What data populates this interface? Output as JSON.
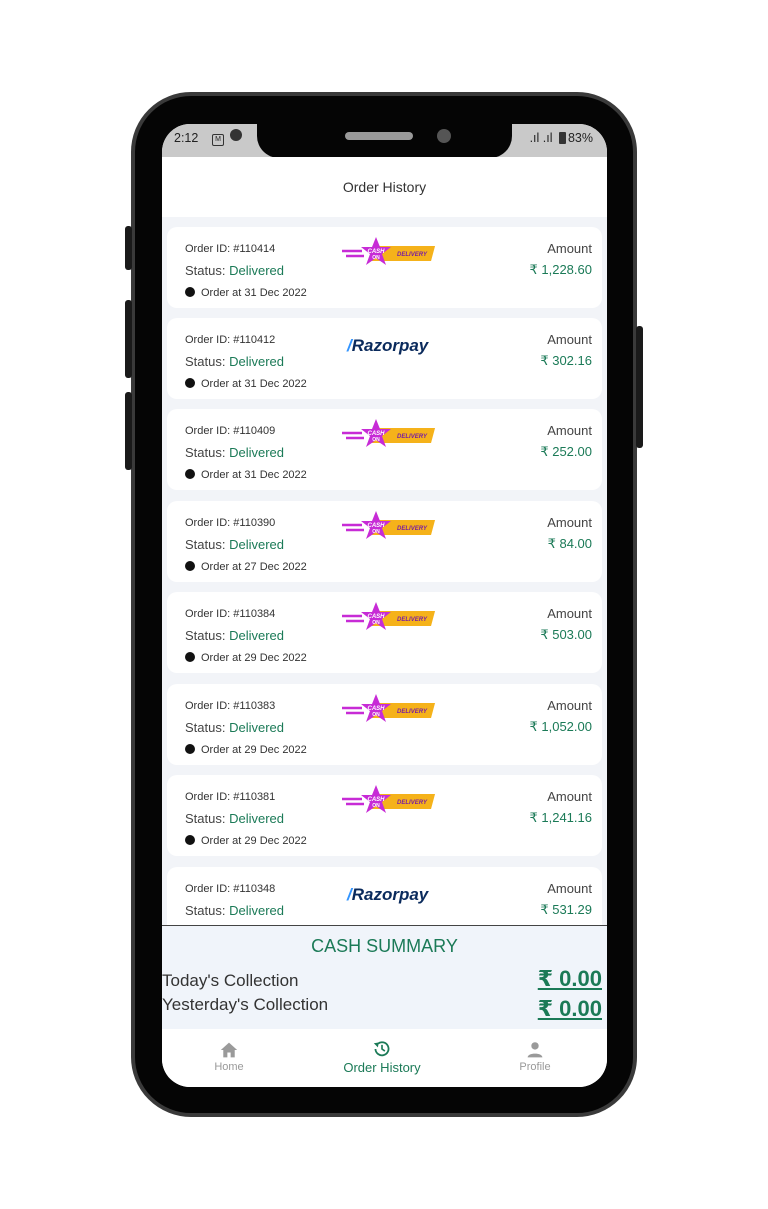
{
  "status_bar": {
    "time": "2:12",
    "battery": "83%"
  },
  "app_bar": {
    "title": "Order History"
  },
  "labels": {
    "status_prefix": "Status: ",
    "amount": "Amount"
  },
  "colors": {
    "accent": "#1b7a57",
    "cod_magenta": "#c72bd6",
    "cod_yellow": "#f5b21a",
    "razorpay_navy": "#0a2a5c"
  },
  "orders": [
    {
      "id": "Order ID: #110414",
      "status": "Delivered",
      "date": "Order at 31 Dec 2022",
      "amount": "₹ 1,228.60",
      "payment": "cod"
    },
    {
      "id": "Order ID: #110412",
      "status": "Delivered",
      "date": "Order at 31 Dec 2022",
      "amount": "₹ 302.16",
      "payment": "razorpay"
    },
    {
      "id": "Order ID: #110409",
      "status": "Delivered",
      "date": "Order at 31 Dec 2022",
      "amount": "₹ 252.00",
      "payment": "cod"
    },
    {
      "id": "Order ID: #110390",
      "status": "Delivered",
      "date": "Order at 27 Dec 2022",
      "amount": "₹ 84.00",
      "payment": "cod"
    },
    {
      "id": "Order ID: #110384",
      "status": "Delivered",
      "date": "Order at 29 Dec 2022",
      "amount": "₹ 503.00",
      "payment": "cod"
    },
    {
      "id": "Order ID: #110383",
      "status": "Delivered",
      "date": "Order at 29 Dec 2022",
      "amount": "₹ 1,052.00",
      "payment": "cod"
    },
    {
      "id": "Order ID: #110381",
      "status": "Delivered",
      "date": "Order at 29 Dec 2022",
      "amount": "₹ 1,241.16",
      "payment": "cod"
    },
    {
      "id": "Order ID: #110348",
      "status": "Delivered",
      "date": "",
      "amount": "₹ 531.29",
      "payment": "razorpay"
    }
  ],
  "payment_logos": {
    "cod": {
      "cash": "CASH",
      "on": "ON",
      "delivery": "DELIVERY"
    },
    "razorpay": {
      "text": "Razorpay"
    }
  },
  "summary": {
    "title": "CASH SUMMARY",
    "today_label": "Today's Collection",
    "today_value": "₹ 0.00",
    "yesterday_label": "Yesterday's Collection",
    "yesterday_value": "₹ 0.00"
  },
  "nav": {
    "items": [
      {
        "label": "Home",
        "icon": "home-icon",
        "active": false
      },
      {
        "label": "Order History",
        "icon": "history-icon",
        "active": true
      },
      {
        "label": "Profile",
        "icon": "person-icon",
        "active": false
      }
    ]
  }
}
